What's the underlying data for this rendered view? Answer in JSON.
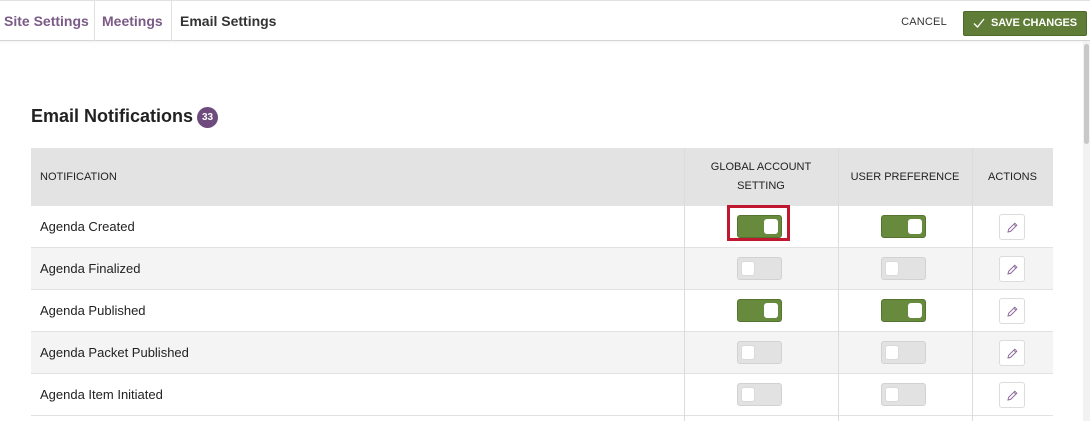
{
  "breadcrumbs": [
    {
      "label": "Site Settings"
    },
    {
      "label": "Meetings"
    },
    {
      "label": "Email Settings"
    }
  ],
  "actions": {
    "cancel_label": "CANCEL",
    "save_label": "SAVE CHANGES"
  },
  "section": {
    "title": "Email Notifications",
    "count": "33"
  },
  "table": {
    "headers": {
      "notification": "NOTIFICATION",
      "global_line1": "GLOBAL ACCOUNT",
      "global_line2": "SETTING",
      "user_preference": "USER PREFERENCE",
      "actions": "ACTIONS"
    },
    "rows": [
      {
        "label": "Agenda Created",
        "global_setting": true,
        "user_preference": true
      },
      {
        "label": "Agenda Finalized",
        "global_setting": false,
        "user_preference": false
      },
      {
        "label": "Agenda Published",
        "global_setting": true,
        "user_preference": true
      },
      {
        "label": "Agenda Packet Published",
        "global_setting": false,
        "user_preference": false
      },
      {
        "label": "Agenda Item Initiated",
        "global_setting": false,
        "user_preference": false
      }
    ]
  },
  "colors": {
    "brand_purple": "#7a5b86",
    "badge_purple": "#6e4b7c",
    "toggle_on": "#678a3d",
    "save_button": "#5f7d37",
    "highlight_red": "#c0182e"
  },
  "icons": {
    "save": "check-icon",
    "edit": "pencil-icon"
  }
}
